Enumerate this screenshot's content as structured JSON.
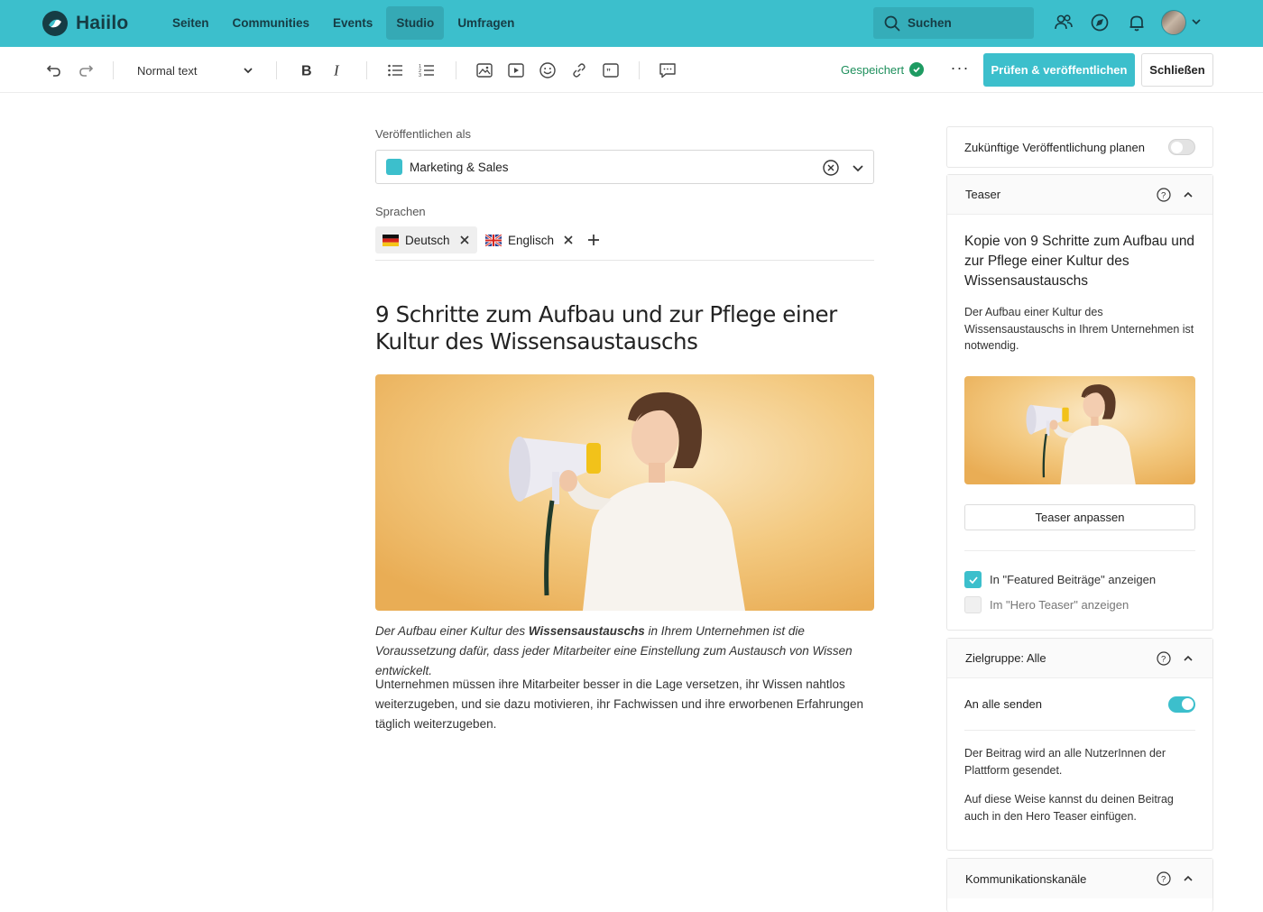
{
  "app": {
    "name": "Haiilo",
    "nav": [
      {
        "label": "Seiten",
        "active": false
      },
      {
        "label": "Communities",
        "active": false
      },
      {
        "label": "Events",
        "active": false
      },
      {
        "label": "Studio",
        "active": true
      },
      {
        "label": "Umfragen",
        "active": false
      }
    ],
    "search_label": "Suchen",
    "icons": [
      "people-icon",
      "compass-icon",
      "bell-icon",
      "avatar",
      "chevron-down-icon"
    ],
    "brand_color": "#3cbfcc"
  },
  "toolbar": {
    "format_select": "Normal text",
    "saved_label": "Gespeichert",
    "more_label": "···",
    "publish_label": "Prüfen & veröffentlichen",
    "close_label": "Schließen"
  },
  "editor": {
    "publish_as_label": "Veröffentlichen als",
    "publish_as_value": "Marketing & Sales",
    "languages_label": "Sprachen",
    "languages": [
      "Deutsch",
      "Englisch"
    ],
    "headline": "9 Schritte zum Aufbau und zur Pflege einer Kultur des Wissensaustauschs",
    "caption_part1": "Der Aufbau einer Kultur des ",
    "caption_bold": "Wissensaustauschs",
    "caption_part2": " in Ihrem Unternehmen ist die Voraussetzung dafür, dass jeder Mitarbeiter eine Einstellung zum Austausch von Wissen entwickelt.",
    "body": "Unternehmen müssen ihre Mitarbeiter besser in die Lage versetzen, ihr Wissen nahtlos weiterzugeben, und sie dazu motivieren, ihr Fachwissen und ihre erworbenen Erfahrungen täglich weiterzugeben."
  },
  "panel": {
    "schedule_label": "Zukünftige Veröffentlichung planen",
    "schedule_on": false,
    "teaser_header": "Teaser",
    "teaser_title": "Kopie von 9 Schritte zum Aufbau und zur Pflege einer Kultur des Wissensaustauschs",
    "teaser_desc": "Der Aufbau einer Kultur des Wissensaustauschs in Ihrem Unternehmen ist notwendig.",
    "teaser_button": "Teaser anpassen",
    "featured_label": "In \"Featured Beiträge\" anzeigen",
    "featured_checked": true,
    "hero_label": "Im \"Hero Teaser\" anzeigen",
    "hero_checked": false,
    "audience_header": "Zielgruppe: Alle",
    "send_all_label": "An alle senden",
    "send_all_on": true,
    "audience_desc1": "Der Beitrag wird an alle NutzerInnen der Plattform gesendet.",
    "audience_desc2": "Auf diese Weise kannst du deinen Beitrag auch in den Hero Teaser einfügen.",
    "channels_header": "Kommunikationskanäle"
  }
}
